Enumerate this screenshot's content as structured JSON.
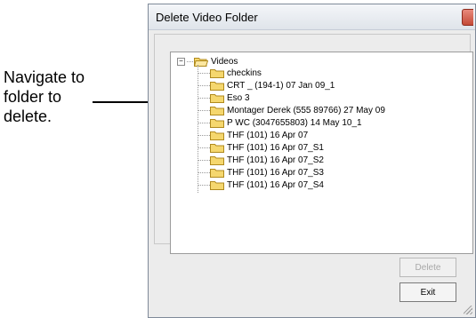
{
  "annotation": {
    "text_line1": "Navigate to",
    "text_line2": "folder to",
    "text_line3": "delete."
  },
  "window": {
    "title": "Delete Video Folder"
  },
  "tree": {
    "root_label": "Videos",
    "items": [
      {
        "label": "checkins"
      },
      {
        "label": "CRT _ (194-1) 07 Jan 09_1"
      },
      {
        "label": "Eso 3"
      },
      {
        "label": "Montager Derek (555 89766) 27 May 09"
      },
      {
        "label": "P WC (3047655803) 14 May 10_1"
      },
      {
        "label": "THF (101) 16 Apr 07"
      },
      {
        "label": "THF (101) 16 Apr 07_S1"
      },
      {
        "label": "THF (101) 16 Apr 07_S2"
      },
      {
        "label": "THF (101) 16 Apr 07_S3"
      },
      {
        "label": "THF (101) 16 Apr 07_S4"
      }
    ]
  },
  "buttons": {
    "delete_label": "Delete",
    "exit_label": "Exit"
  },
  "icons": {
    "folder": "folder-icon",
    "open_folder": "open-folder-icon",
    "close": "close-icon",
    "expander": "collapse-icon",
    "grip": "resize-grip-icon"
  },
  "colors": {
    "folder_fill": "#f5d76e",
    "folder_stroke": "#b08a1e",
    "close_button": "#c44a37"
  }
}
